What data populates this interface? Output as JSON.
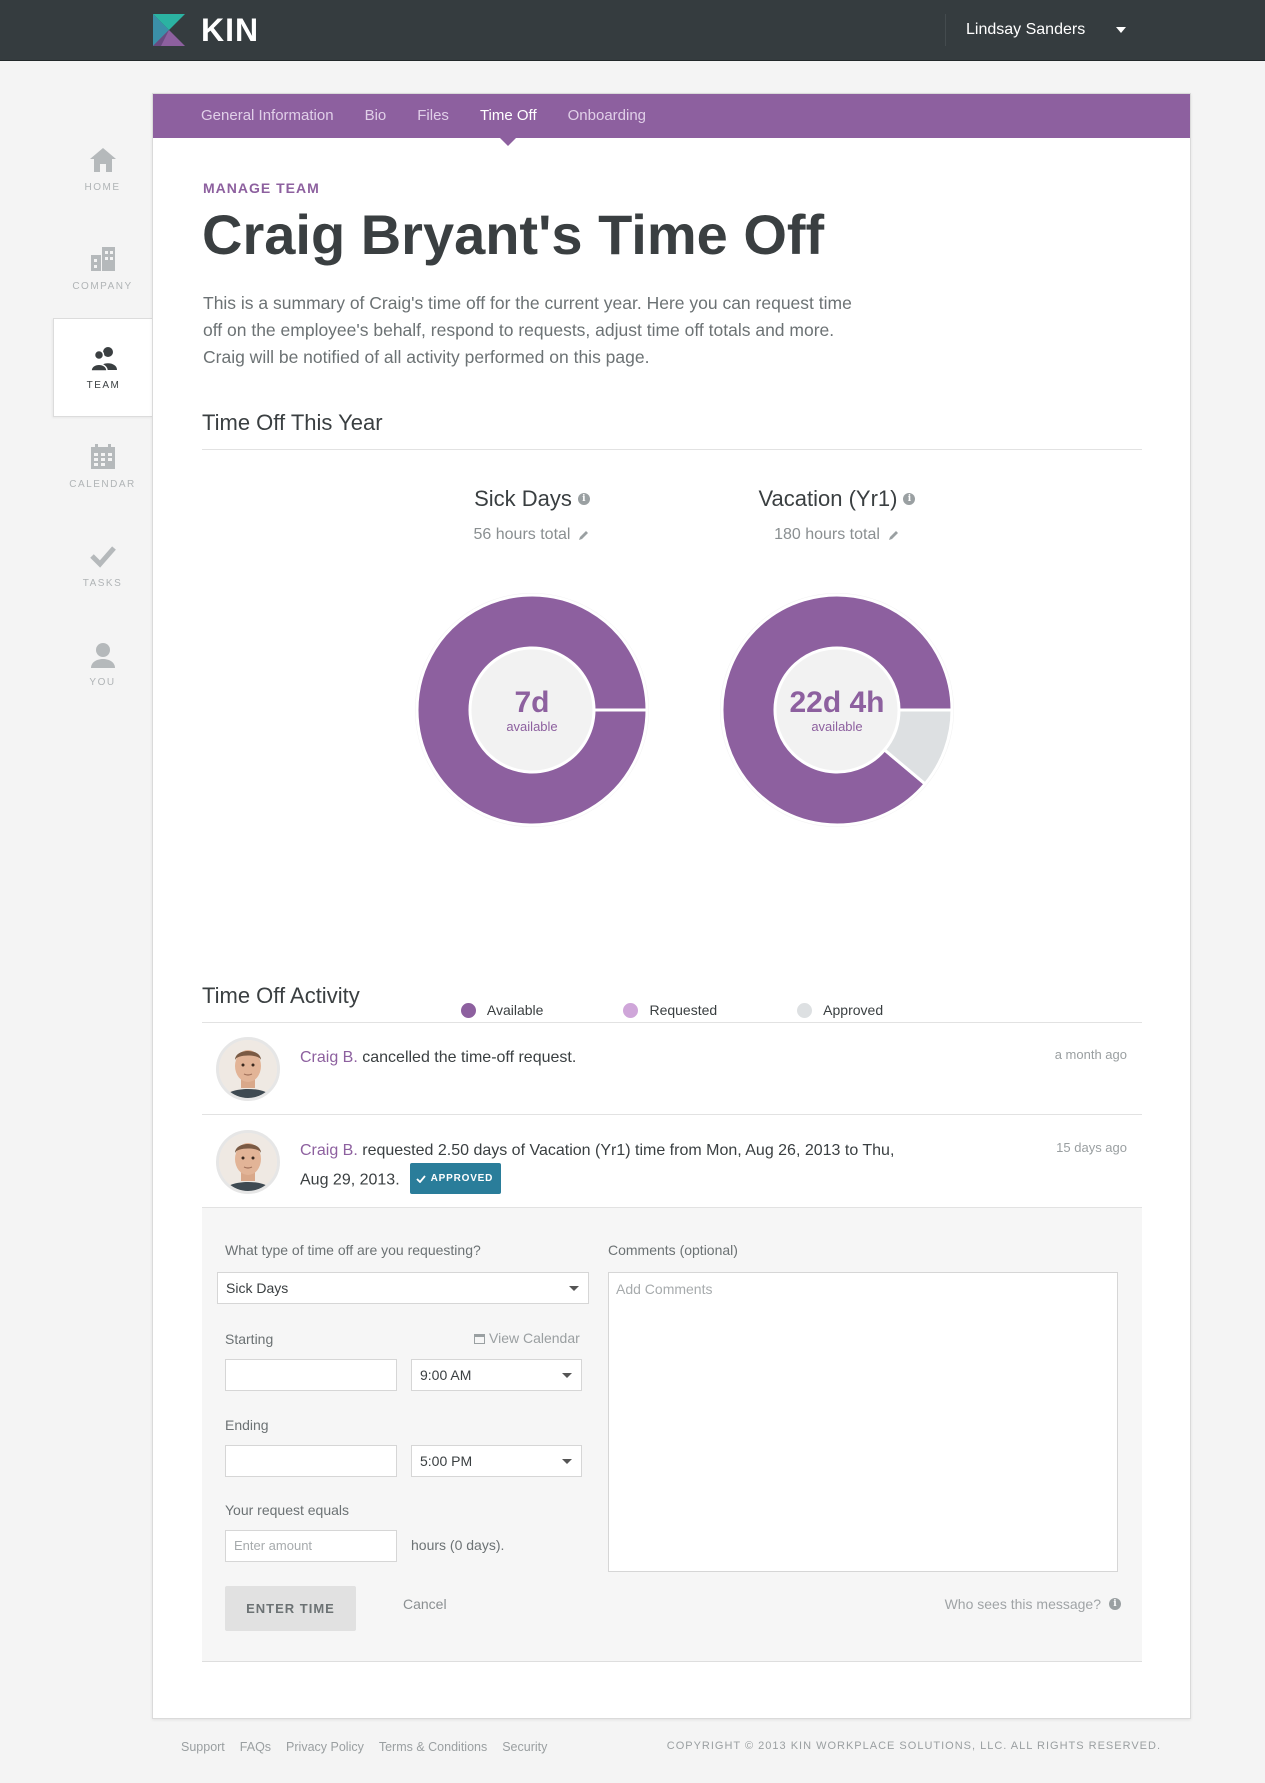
{
  "app": {
    "logo_text": "KIN",
    "user_name": "Lindsay Sanders"
  },
  "sidebar": {
    "items": [
      {
        "label": "HOME",
        "icon": "home-icon"
      },
      {
        "label": "COMPANY",
        "icon": "building-icon"
      },
      {
        "label": "TEAM",
        "icon": "team-icon",
        "active": true
      },
      {
        "label": "CALENDAR",
        "icon": "calendar-icon"
      },
      {
        "label": "TASKS",
        "icon": "checkmark-icon"
      },
      {
        "label": "YOU",
        "icon": "person-icon"
      }
    ]
  },
  "tabs": [
    {
      "label": "General Information"
    },
    {
      "label": "Bio"
    },
    {
      "label": "Files"
    },
    {
      "label": "Time Off",
      "active": true
    },
    {
      "label": "Onboarding"
    }
  ],
  "header": {
    "breadcrumb": "MANAGE TEAM",
    "title": "Craig Bryant's Time Off",
    "intro": "This is a summary of Craig's time off for the current year. Here you can request time off on the employee's behalf, respond to requests, adjust time off totals and more. Craig will be notified of all activity performed on this page."
  },
  "summary": {
    "section_title": "Time Off This Year",
    "charts": [
      {
        "name": "Sick Days",
        "total": "56 hours total",
        "center_value": "7d",
        "center_label": "available"
      },
      {
        "name": "Vacation (Yr1)",
        "total": "180 hours total",
        "center_value": "22d 4h",
        "center_label": "available"
      }
    ],
    "legend": [
      {
        "label": "Available",
        "color": "#8d609f"
      },
      {
        "label": "Requested",
        "color": "#cfa6d9"
      },
      {
        "label": "Approved",
        "color": "#dde0e2"
      }
    ]
  },
  "chart_data": [
    {
      "type": "pie",
      "title": "Sick Days",
      "categories": [
        "Available",
        "Requested",
        "Approved"
      ],
      "values": [
        56,
        0,
        0
      ],
      "colors": [
        "#8d609f",
        "#cfa6d9",
        "#dde0e2"
      ]
    },
    {
      "type": "pie",
      "title": "Vacation (Yr1)",
      "categories": [
        "Available",
        "Requested",
        "Approved"
      ],
      "values": [
        160,
        0,
        20
      ],
      "colors": [
        "#8d609f",
        "#cfa6d9",
        "#dde0e2"
      ]
    }
  ],
  "activity": {
    "section_title": "Time Off Activity",
    "items": [
      {
        "who": "Craig B.",
        "text": " cancelled the time-off request.",
        "time": "a month ago"
      },
      {
        "who": "Craig B.",
        "text": " requested 2.50 days of Vacation (Yr1) time from Mon, Aug 26, 2013 to Thu, Aug 29, 2013.",
        "time": "15 days ago",
        "badge": "APPROVED"
      }
    ]
  },
  "form": {
    "type_label": "What type of time off are you requesting?",
    "type_value": "Sick Days",
    "view_calendar": "View Calendar",
    "starting_label": "Starting",
    "starting_time": "9:00 AM",
    "ending_label": "Ending",
    "ending_time": "5:00 PM",
    "equals_label": "Your request equals",
    "amount_placeholder": "Enter amount",
    "amount_suffix": "hours (0 days).",
    "comments_label": "Comments (optional)",
    "comments_placeholder": "Add Comments",
    "submit_label": "ENTER TIME",
    "cancel_label": "Cancel",
    "who_sees": "Who sees this message?"
  },
  "footer": {
    "links": [
      "Support",
      "FAQs",
      "Privacy Policy",
      "Terms & Conditions",
      "Security"
    ],
    "copyright": "COPYRIGHT © 2013 KIN WORKPLACE SOLUTIONS, LLC. ALL RIGHTS RESERVED."
  }
}
